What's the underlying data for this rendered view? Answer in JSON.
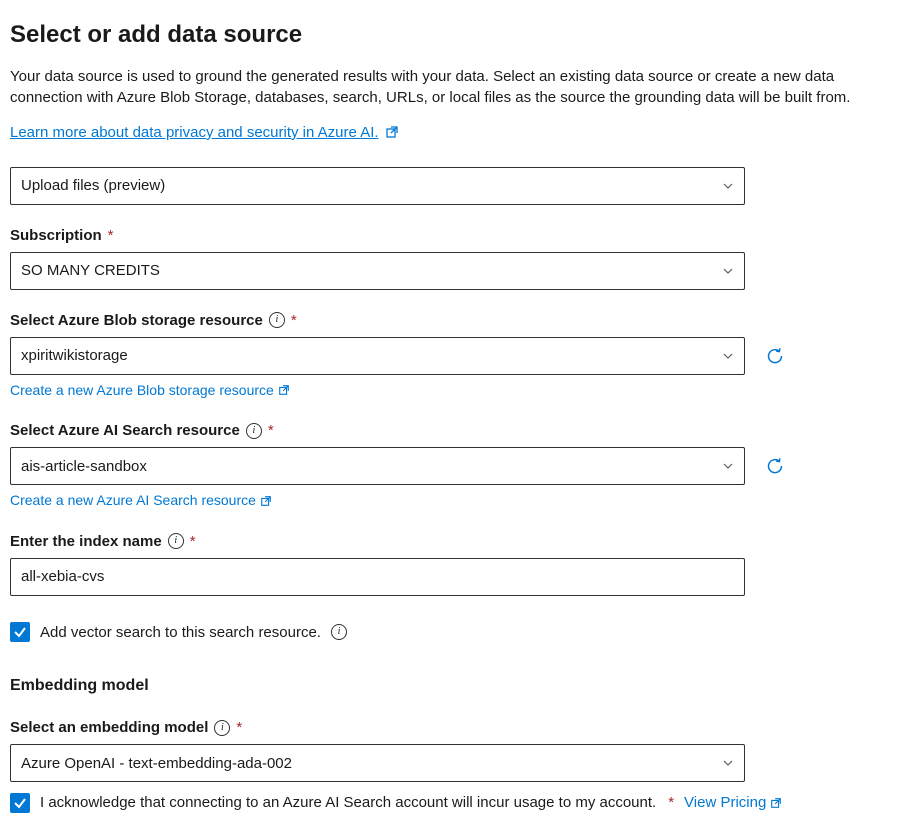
{
  "title": "Select or add data source",
  "description": "Your data source is used to ground the generated results with your data. Select an existing data source or create a new data connection with Azure Blob Storage, databases, search, URLs, or local files as the source the grounding data will be built from.",
  "learn_more_link": "Learn more about data privacy and security in Azure AI.",
  "data_source": {
    "value": "Upload files (preview)"
  },
  "subscription": {
    "label": "Subscription",
    "value": "SO MANY CREDITS"
  },
  "blob_storage": {
    "label": "Select Azure Blob storage resource",
    "value": "xpiritwikistorage",
    "create_link": "Create a new Azure Blob storage resource"
  },
  "ai_search": {
    "label": "Select Azure AI Search resource",
    "value": "ais-article-sandbox",
    "create_link": "Create a new Azure AI Search resource"
  },
  "index_name": {
    "label": "Enter the index name",
    "value": "all-xebia-cvs"
  },
  "vector_search": {
    "label": "Add vector search to this search resource."
  },
  "embedding": {
    "heading": "Embedding model",
    "label": "Select an embedding model",
    "value": "Azure OpenAI - text-embedding-ada-002"
  },
  "acknowledgment": {
    "text": "I acknowledge that connecting to an Azure AI Search account will incur usage to my account.",
    "pricing_link": "View Pricing"
  },
  "required_marker": "*"
}
